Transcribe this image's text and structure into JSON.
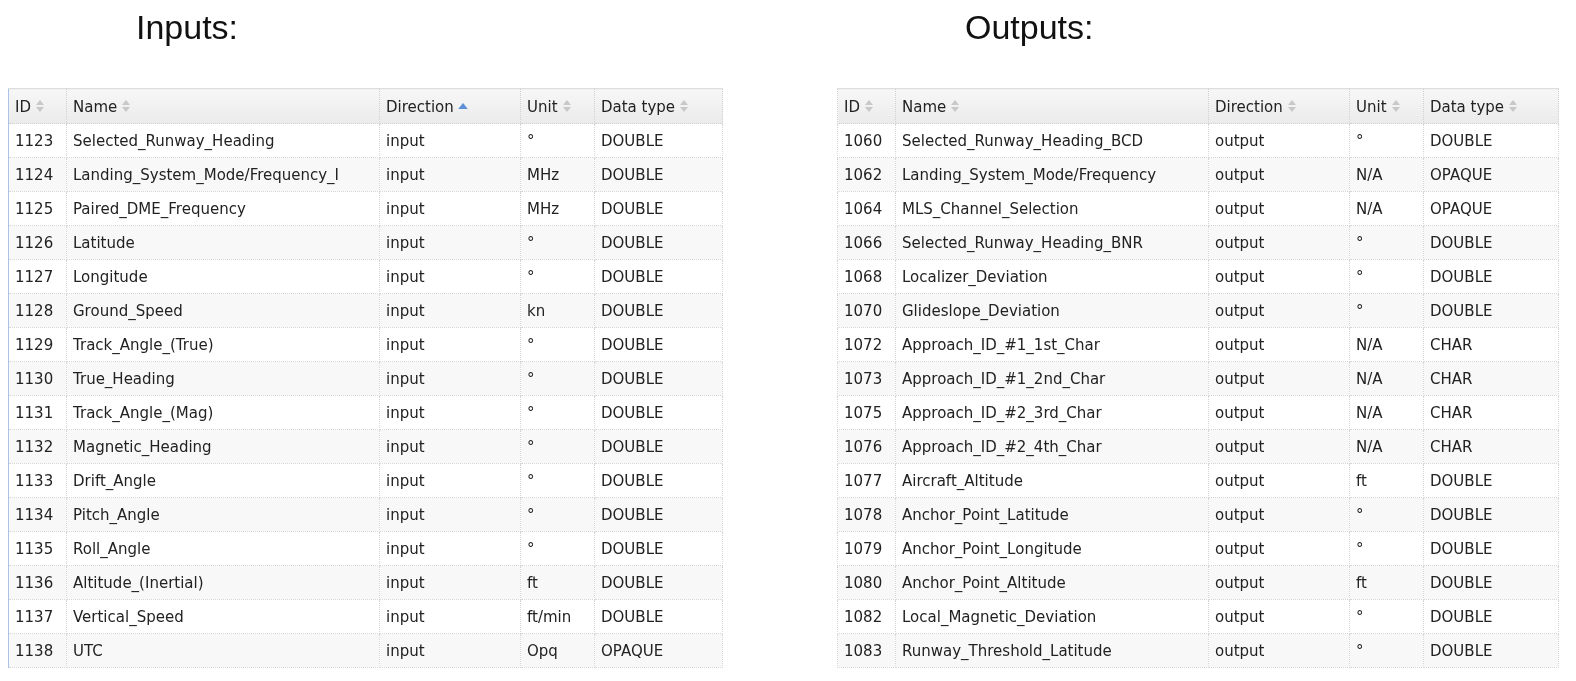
{
  "panels": [
    {
      "heading": "Inputs:",
      "columns": [
        {
          "label": "ID",
          "sorted": false
        },
        {
          "label": "Name",
          "sorted": false
        },
        {
          "label": "Direction",
          "sorted": true
        },
        {
          "label": "Unit",
          "sorted": false
        },
        {
          "label": "Data type",
          "sorted": false
        }
      ],
      "rows": [
        [
          "1123",
          "Selected_Runway_Heading",
          "input",
          "°",
          "DOUBLE"
        ],
        [
          "1124",
          "Landing_System_Mode/Frequency_I",
          "input",
          "MHz",
          "DOUBLE"
        ],
        [
          "1125",
          "Paired_DME_Frequency",
          "input",
          "MHz",
          "DOUBLE"
        ],
        [
          "1126",
          "Latitude",
          "input",
          "°",
          "DOUBLE"
        ],
        [
          "1127",
          "Longitude",
          "input",
          "°",
          "DOUBLE"
        ],
        [
          "1128",
          "Ground_Speed",
          "input",
          "kn",
          "DOUBLE"
        ],
        [
          "1129",
          "Track_Angle_(True)",
          "input",
          "°",
          "DOUBLE"
        ],
        [
          "1130",
          "True_Heading",
          "input",
          "°",
          "DOUBLE"
        ],
        [
          "1131",
          "Track_Angle_(Mag)",
          "input",
          "°",
          "DOUBLE"
        ],
        [
          "1132",
          "Magnetic_Heading",
          "input",
          "°",
          "DOUBLE"
        ],
        [
          "1133",
          "Drift_Angle",
          "input",
          "°",
          "DOUBLE"
        ],
        [
          "1134",
          "Pitch_Angle",
          "input",
          "°",
          "DOUBLE"
        ],
        [
          "1135",
          "Roll_Angle",
          "input",
          "°",
          "DOUBLE"
        ],
        [
          "1136",
          "Altitude_(Inertial)",
          "input",
          "ft",
          "DOUBLE"
        ],
        [
          "1137",
          "Vertical_Speed",
          "input",
          "ft/min",
          "DOUBLE"
        ],
        [
          "1138",
          "UTC",
          "input",
          "Opq",
          "OPAQUE"
        ]
      ]
    },
    {
      "heading": "Outputs:",
      "columns": [
        {
          "label": "ID",
          "sorted": false
        },
        {
          "label": "Name",
          "sorted": false
        },
        {
          "label": "Direction",
          "sorted": false
        },
        {
          "label": "Unit",
          "sorted": false
        },
        {
          "label": "Data type",
          "sorted": false
        }
      ],
      "rows": [
        [
          "1060",
          "Selected_Runway_Heading_BCD",
          "output",
          "°",
          "DOUBLE"
        ],
        [
          "1062",
          "Landing_System_Mode/Frequency",
          "output",
          "N/A",
          "OPAQUE"
        ],
        [
          "1064",
          "MLS_Channel_Selection",
          "output",
          "N/A",
          "OPAQUE"
        ],
        [
          "1066",
          "Selected_Runway_Heading_BNR",
          "output",
          "°",
          "DOUBLE"
        ],
        [
          "1068",
          "Localizer_Deviation",
          "output",
          "°",
          "DOUBLE"
        ],
        [
          "1070",
          "Glideslope_Deviation",
          "output",
          "°",
          "DOUBLE"
        ],
        [
          "1072",
          "Approach_ID_#1_1st_Char",
          "output",
          "N/A",
          "CHAR"
        ],
        [
          "1073",
          "Approach_ID_#1_2nd_Char",
          "output",
          "N/A",
          "CHAR"
        ],
        [
          "1075",
          "Approach_ID_#2_3rd_Char",
          "output",
          "N/A",
          "CHAR"
        ],
        [
          "1076",
          "Approach_ID_#2_4th_Char",
          "output",
          "N/A",
          "CHAR"
        ],
        [
          "1077",
          "Aircraft_Altitude",
          "output",
          "ft",
          "DOUBLE"
        ],
        [
          "1078",
          "Anchor_Point_Latitude",
          "output",
          "°",
          "DOUBLE"
        ],
        [
          "1079",
          "Anchor_Point_Longitude",
          "output",
          "°",
          "DOUBLE"
        ],
        [
          "1080",
          "Anchor_Point_Altitude",
          "output",
          "ft",
          "DOUBLE"
        ],
        [
          "1082",
          "Local_Magnetic_Deviation",
          "output",
          "°",
          "DOUBLE"
        ],
        [
          "1083",
          "Runway_Threshold_Latitude",
          "output",
          "°",
          "DOUBLE"
        ]
      ]
    }
  ]
}
